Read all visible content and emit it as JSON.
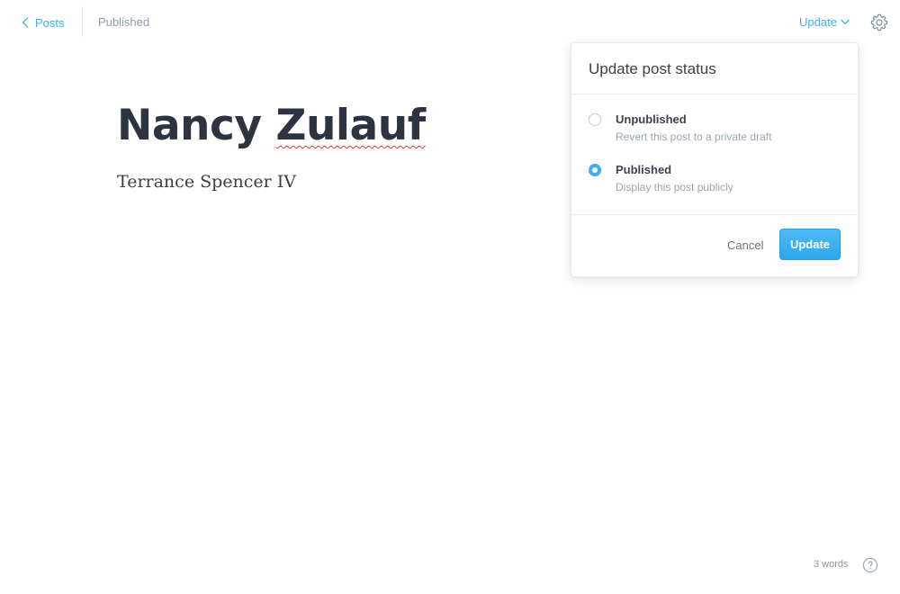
{
  "topbar": {
    "back_label": "Posts",
    "status": "Published",
    "update_label": "Update"
  },
  "editor": {
    "title_part1": "Nancy ",
    "title_part2": "Zulauf",
    "body": "Terrance Spencer IV"
  },
  "popover": {
    "title": "Update post status",
    "options": [
      {
        "label": "Unpublished",
        "description": "Revert this post to a private draft",
        "selected": false
      },
      {
        "label": "Published",
        "description": "Display this post publicly",
        "selected": true
      }
    ],
    "cancel_label": "Cancel",
    "update_label": "Update"
  },
  "footer": {
    "word_count": "3 words"
  },
  "colors": {
    "accent": "#3eb0ef",
    "title": "#2b3440",
    "muted": "#8e9cac"
  },
  "icons": {
    "back": "chevron-left-icon",
    "dropdown": "chevron-down-icon",
    "settings": "gear-icon",
    "help": "question-circle-icon"
  }
}
